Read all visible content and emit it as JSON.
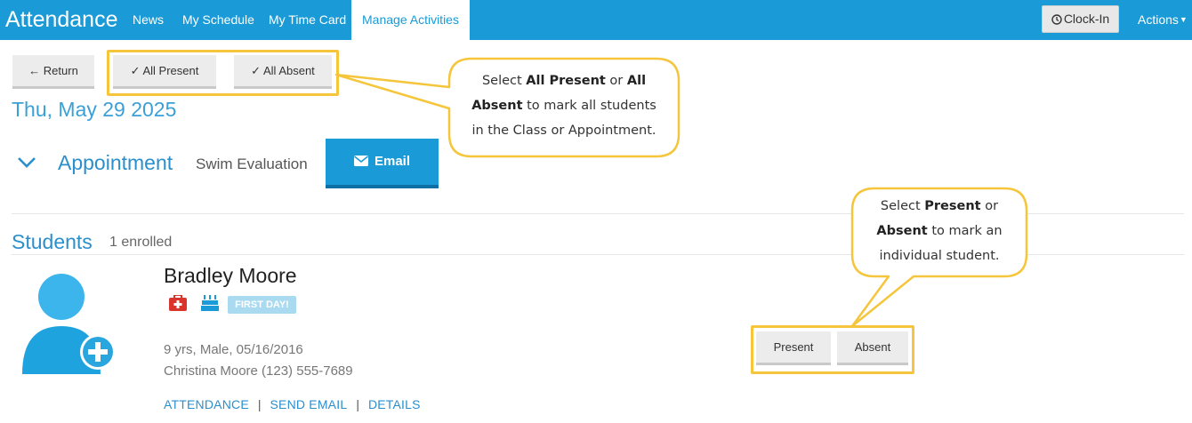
{
  "nav": {
    "brand": "Attendance",
    "links": [
      "News",
      "My Schedule",
      "My Time Card"
    ],
    "active": "Manage Activities",
    "clockin": "Clock-In",
    "actions": "Actions"
  },
  "toolbar": {
    "return": "Return",
    "all_present": "All Present",
    "all_absent": "All Absent"
  },
  "date": "Thu, May 29 2025",
  "appointment": {
    "label": "Appointment",
    "name": "Swim Evaluation",
    "email": "Email"
  },
  "students_section": {
    "title": "Students",
    "count": "1 enrolled"
  },
  "student": {
    "name": "Bradley Moore",
    "badge": "FIRST DAY!",
    "details": "9 yrs, Male, 05/16/2016",
    "contact": "Christina Moore (123) 555-7689",
    "links": [
      "ATTENDANCE",
      "SEND EMAIL",
      "DETAILS"
    ],
    "present": "Present",
    "absent": "Absent"
  },
  "callouts": {
    "top": {
      "l1a": "Select ",
      "l1b": "All Present",
      "l1c": " or ",
      "l1d": "All",
      "l2a": "Absent",
      "l2b": " to mark all students",
      "l3": "in the Class or Appointment."
    },
    "right": {
      "l1a": "Select ",
      "l1b": "Present",
      "l1c": " or",
      "l2a": "Absent",
      "l2b": " to mark an",
      "l3": "individual student."
    }
  },
  "colors": {
    "nav_blue": "#1a9ad6",
    "highlight": "#f5c53b",
    "link_blue": "#2b8fcc"
  }
}
